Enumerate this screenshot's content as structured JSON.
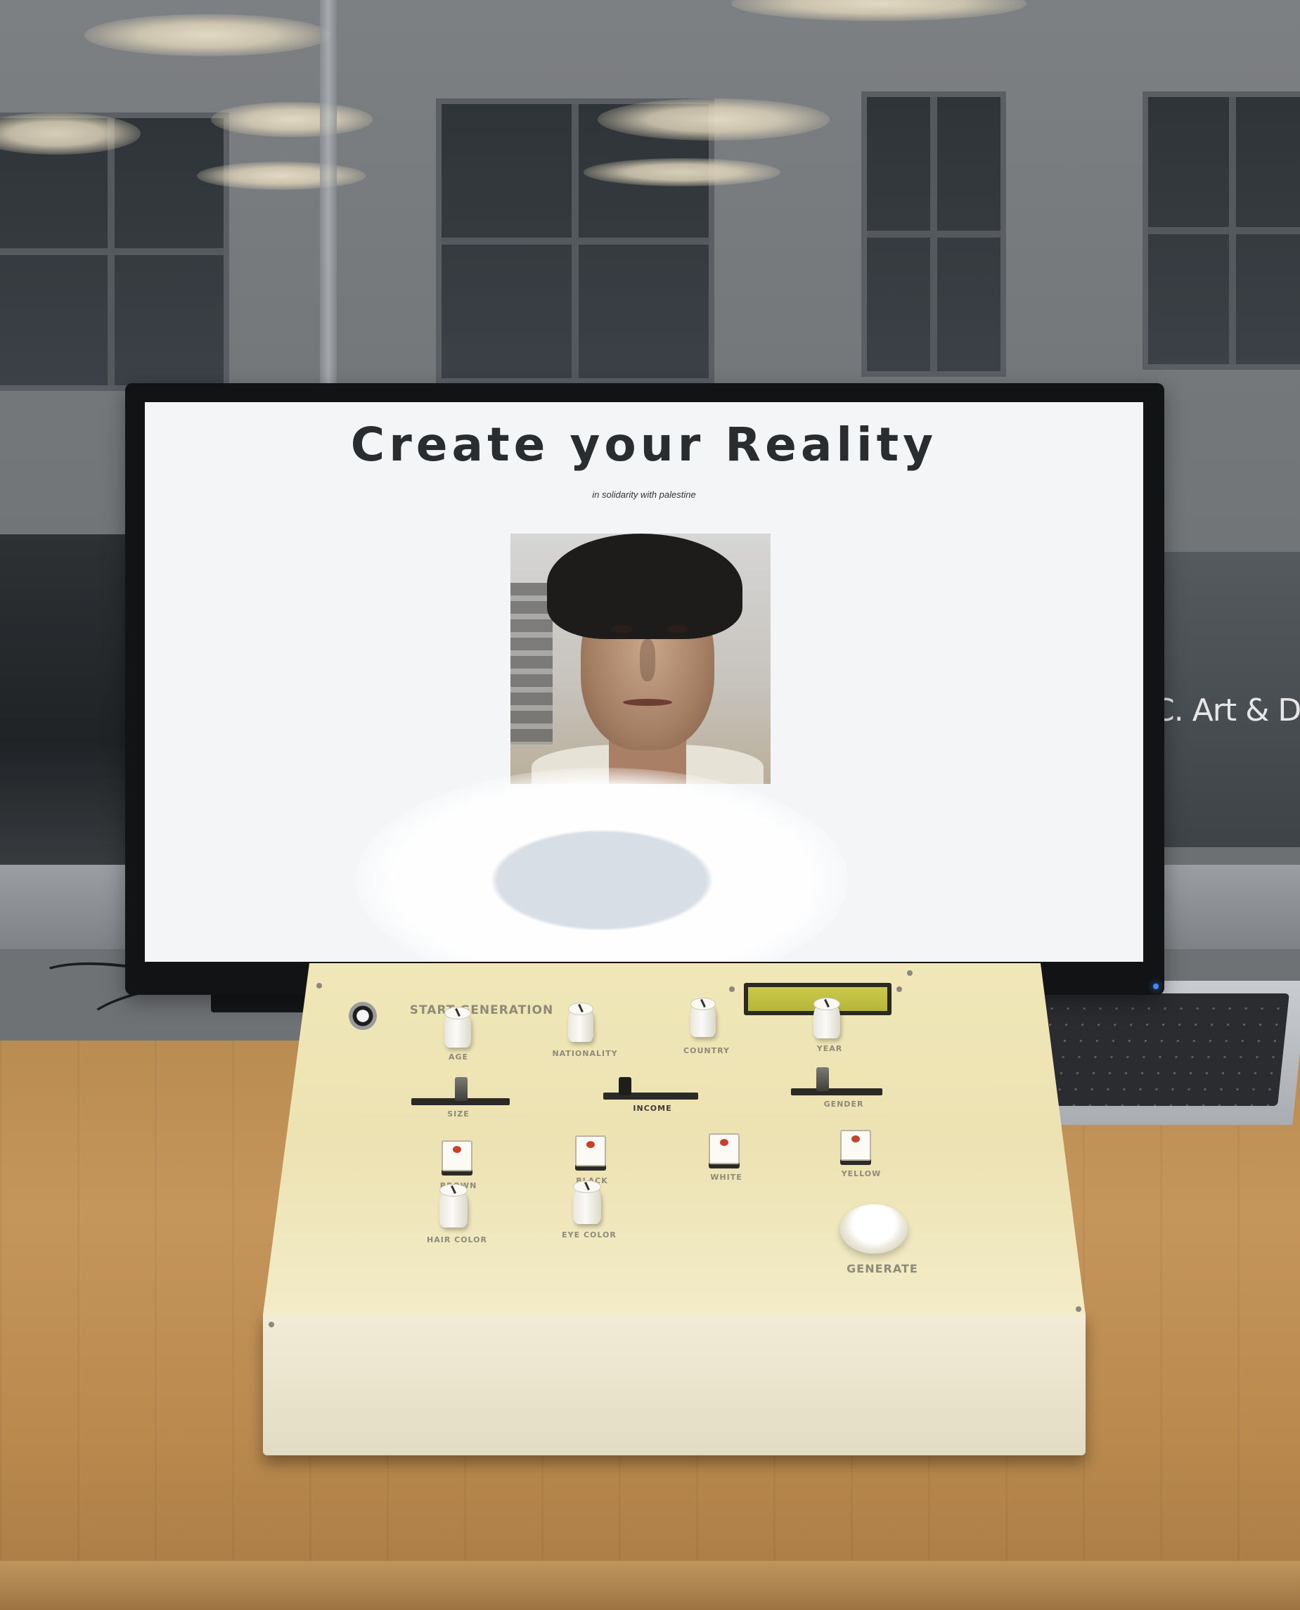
{
  "screen": {
    "title": "Create your Reality",
    "subtitle": "in solidarity with palestine"
  },
  "background": {
    "shop_sign": "C. Art & Dra"
  },
  "control_box": {
    "start_label": "START GENERATION",
    "knobs": [
      "AGE",
      "NATIONALITY",
      "COUNTRY",
      "YEAR",
      "HAIR COLOR",
      "EYE COLOR"
    ],
    "sliders": [
      "SIZE",
      "INCOME",
      "GENDER"
    ],
    "toggles": [
      "BROWN",
      "BLACK",
      "WHITE",
      "YELLOW"
    ],
    "generate_label": "GENERATE"
  },
  "colors": {
    "box": "#ece2b2",
    "screen_bg": "#f3f5f7",
    "title_text": "#2a2d30",
    "table": "#c5965c",
    "lcd": "#c9c94a"
  }
}
